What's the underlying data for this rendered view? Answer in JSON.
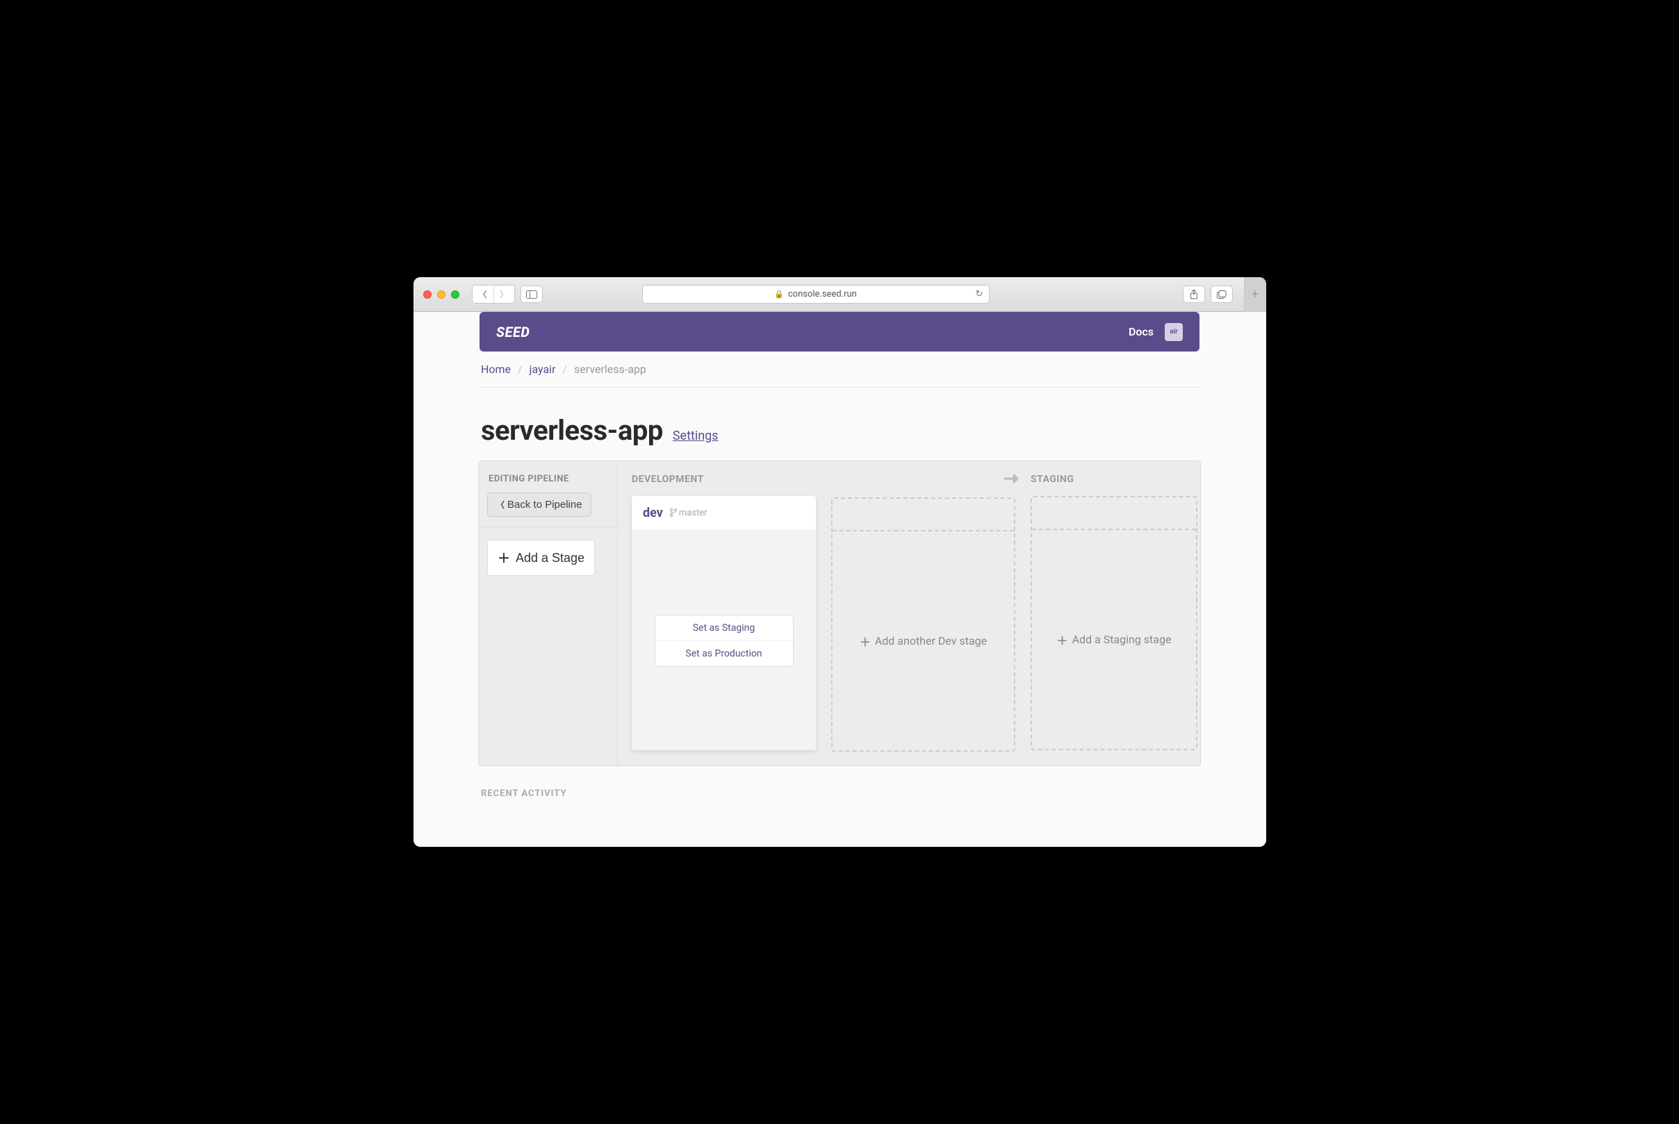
{
  "browser": {
    "address": "console.seed.run"
  },
  "topnav": {
    "logo": "SEED",
    "docs": "Docs",
    "avatar": "air"
  },
  "breadcrumb": {
    "home": "Home",
    "org": "jayair",
    "app": "serverless-app"
  },
  "page": {
    "title": "serverless-app",
    "settings": "Settings"
  },
  "editing": {
    "header": "EDITING PIPELINE",
    "back": "Back to Pipeline",
    "add_stage": "Add a Stage"
  },
  "columns": {
    "development": "DEVELOPMENT",
    "staging": "STAGING"
  },
  "dev_card": {
    "name": "dev",
    "branch": "master",
    "set_staging": "Set as Staging",
    "set_production": "Set as Production"
  },
  "placeholders": {
    "add_dev": "Add another Dev stage",
    "add_staging": "Add a Staging stage"
  },
  "recent_activity": "RECENT ACTIVITY"
}
